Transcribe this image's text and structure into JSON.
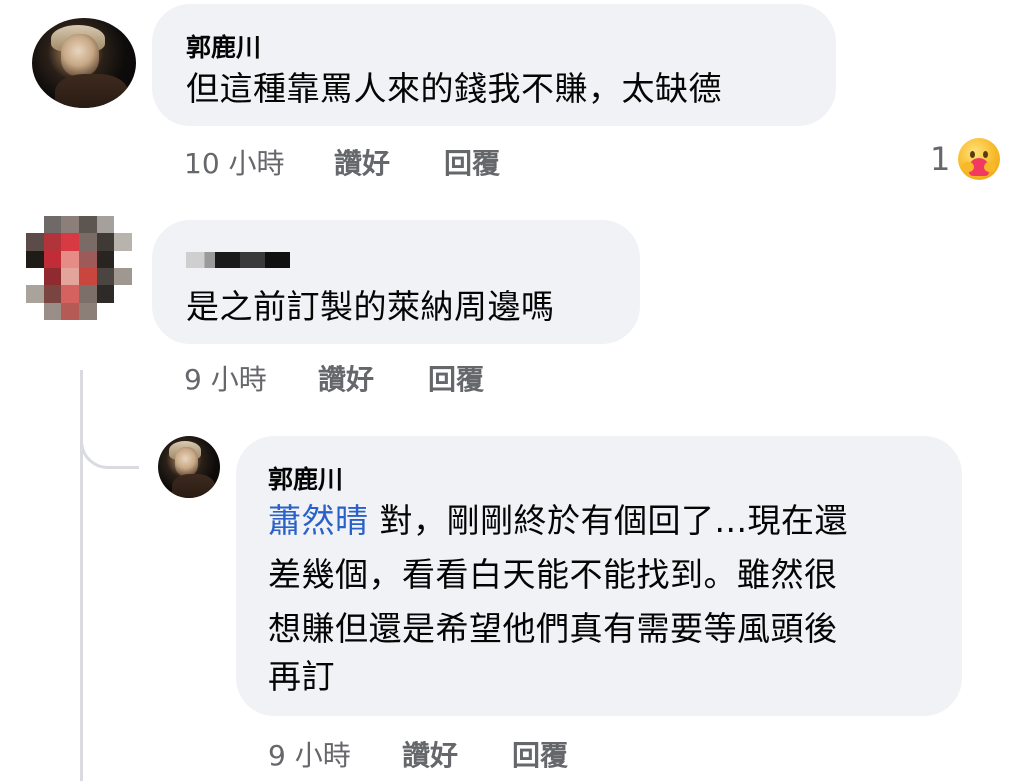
{
  "comments": [
    {
      "author": "郭鹿川",
      "text": "但這種靠罵人來的錢我不賺，太缺德",
      "time": "10 小時",
      "like_label": "讚好",
      "reply_label": "回覆",
      "reaction_count": "1",
      "reaction_icon": "care-reaction-icon"
    },
    {
      "author": "",
      "text": "是之前訂製的萊納周邊嗎",
      "time": "9 小時",
      "like_label": "讚好",
      "reply_label": "回覆"
    },
    {
      "author": "郭鹿川",
      "mention": "蕭然晴",
      "text_line1": " 對，剛剛終於有個回了...現在還",
      "text_line2": "差幾個，看看白天能不能找到。雖然很",
      "text_line3": "想賺但還是希望他們真有需要等風頭後",
      "text_line4": "再訂",
      "time": "9 小時",
      "like_label": "讚好",
      "reply_label": "回覆"
    }
  ],
  "colors": {
    "bubble": "#f0f2f5",
    "meta_text": "#65676b",
    "mention": "#2a61c9"
  }
}
